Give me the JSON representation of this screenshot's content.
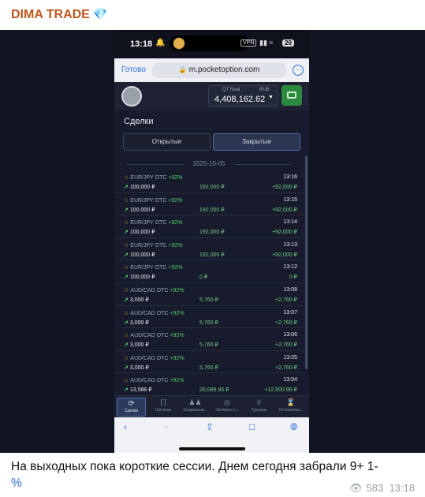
{
  "post": {
    "channel_name": "DIMA TRADE",
    "channel_icon": "gem-icon",
    "caption": "На выходных пока короткие сессии. Днем сегодня забрали 9+ 1-",
    "caption_emoji": "%",
    "views": "583",
    "time": "13:18"
  },
  "phone": {
    "status": {
      "time": "13:18",
      "vpn": "VPN",
      "battery": "20"
    },
    "browser": {
      "done_label": "Готово",
      "url": "m.pocketoption.com"
    },
    "account": {
      "type": "QT Real",
      "currency": "RUB",
      "balance": "4,408,162.62"
    },
    "trades_title": "Сделки",
    "tabs": {
      "open": "Открытые",
      "closed": "Закрытые"
    },
    "date": "2025-10-05",
    "trades": [
      {
        "pair": "EUR/JPY OTC",
        "pct": "+92%",
        "time": "13:16",
        "stake": "100,000 ₽",
        "payout": "192,000 ₽",
        "profit": "+92,000 ₽"
      },
      {
        "pair": "EUR/JPY OTC",
        "pct": "+92%",
        "time": "13:15",
        "stake": "100,000 ₽",
        "payout": "192,000 ₽",
        "profit": "+92,000 ₽"
      },
      {
        "pair": "EUR/JPY OTC",
        "pct": "+92%",
        "time": "13:14",
        "stake": "100,000 ₽",
        "payout": "192,000 ₽",
        "profit": "+92,000 ₽"
      },
      {
        "pair": "EUR/JPY OTC",
        "pct": "+92%",
        "time": "13:13",
        "stake": "100,000 ₽",
        "payout": "192,000 ₽",
        "profit": "+92,000 ₽"
      },
      {
        "pair": "EUR/JPY OTC",
        "pct": "+92%",
        "time": "13:12",
        "stake": "100,000 ₽",
        "payout": "0 ₽",
        "profit": "0 ₽"
      },
      {
        "pair": "AUD/CAD OTC",
        "pct": "+92%",
        "time": "13:08",
        "stake": "3,000 ₽",
        "payout": "5,760 ₽",
        "profit": "+2,760 ₽"
      },
      {
        "pair": "AUD/CAD OTC",
        "pct": "+92%",
        "time": "13:07",
        "stake": "3,000 ₽",
        "payout": "5,760 ₽",
        "profit": "+2,760 ₽"
      },
      {
        "pair": "AUD/CAD OTC",
        "pct": "+92%",
        "time": "13:06",
        "stake": "3,000 ₽",
        "payout": "5,760 ₽",
        "profit": "+2,760 ₽"
      },
      {
        "pair": "AUD/CAD OTC",
        "pct": "+92%",
        "time": "13:05",
        "stake": "3,000 ₽",
        "payout": "5,760 ₽",
        "profit": "+2,760 ₽"
      },
      {
        "pair": "AUD/CAD OTC",
        "pct": "+92%",
        "time": "13:04",
        "stake": "13,588 ₽",
        "payout": "26,088.96 ₽",
        "profit": "+12,500.96 ₽"
      }
    ],
    "bottom_tabs": [
      {
        "label": "Сделки",
        "icon": "history-icon"
      },
      {
        "label": "Сигналы",
        "icon": "signal-icon"
      },
      {
        "label": "Социальна...",
        "icon": "people-icon"
      },
      {
        "label": "Экспресс с...",
        "icon": "target-icon"
      },
      {
        "label": "Турниры",
        "icon": "trophy-icon"
      },
      {
        "label": "Отложенна...",
        "icon": "hourglass-icon"
      }
    ]
  },
  "colors": {
    "channel_name": "#c0561c",
    "profit_green": "#6fd182",
    "accent_blue": "#2a6de0"
  }
}
